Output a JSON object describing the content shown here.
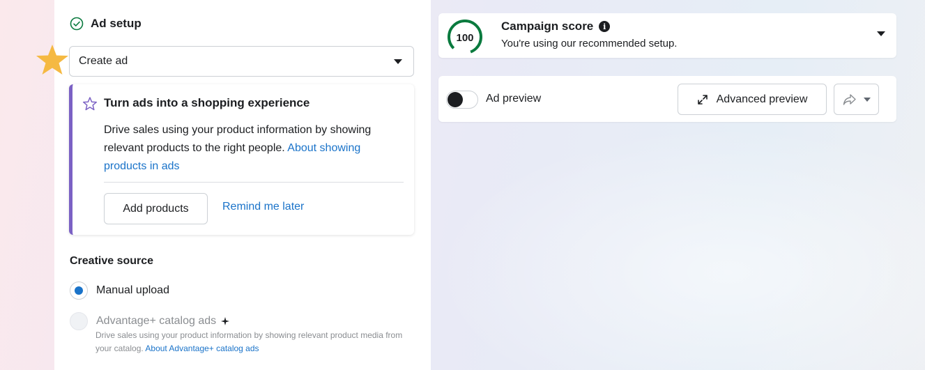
{
  "ad_setup": {
    "title": "Ad setup",
    "select_value": "Create ad"
  },
  "promo": {
    "title": "Turn ads into a shopping experience",
    "body": "Drive sales using your product information by showing relevant products to the right people.",
    "link": "About showing products in ads",
    "primary_button": "Add products",
    "secondary_link": "Remind me later"
  },
  "creative_source": {
    "heading": "Creative source",
    "options": [
      {
        "label": "Manual upload",
        "selected": true
      },
      {
        "label": "Advantage+ catalog ads",
        "selected": false
      }
    ],
    "advantage_desc": "Drive sales using your product information by showing relevant product media from your catalog.",
    "advantage_link": "About Advantage+ catalog ads"
  },
  "campaign_score": {
    "score": "100",
    "title": "Campaign score",
    "subtitle": "You're using our recommended setup."
  },
  "preview": {
    "label": "Ad preview",
    "advanced_button": "Advanced preview"
  },
  "colors": {
    "accent_blue": "#1a73c9",
    "promo_bar": "#7b61c4",
    "score_green": "#0a7a3e",
    "star_gold": "#f5b942"
  },
  "icons": [
    "check-circle-icon",
    "star-badge-icon",
    "star-outline-icon",
    "info-icon",
    "expand-icon",
    "share-icon",
    "chevron-down-icon",
    "sparkle-icon"
  ]
}
